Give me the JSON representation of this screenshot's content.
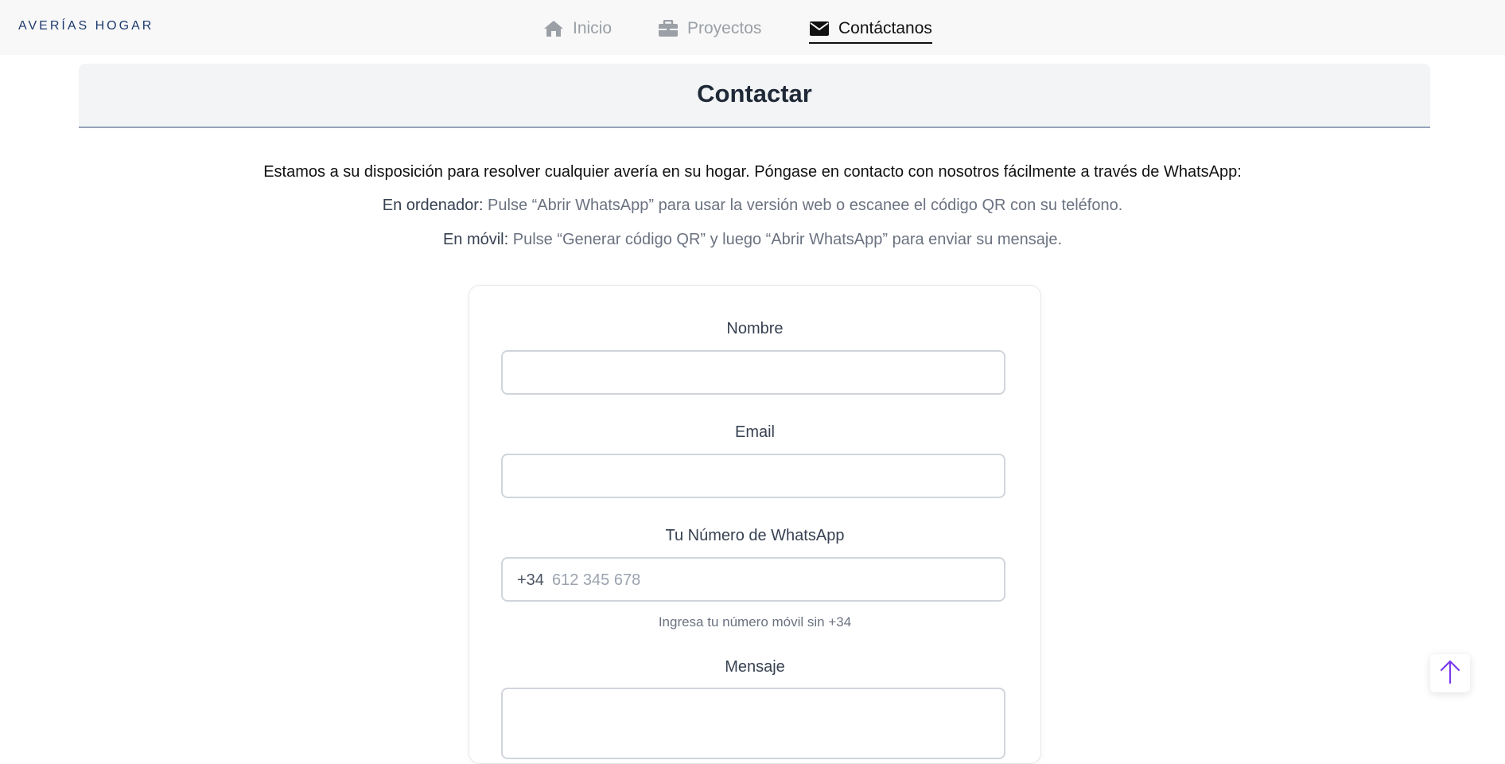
{
  "brand": "AVERÍAS HOGAR",
  "nav": {
    "items": [
      {
        "label": "Inicio",
        "icon": "home-icon",
        "active": false
      },
      {
        "label": "Proyectos",
        "icon": "briefcase-icon",
        "active": false
      },
      {
        "label": "Contáctanos",
        "icon": "envelope-icon",
        "active": true
      }
    ]
  },
  "page": {
    "title": "Contactar"
  },
  "intro": {
    "line1": "Estamos a su disposición para resolver cualquier avería en su hogar. Póngase en contacto con nosotros fácilmente a través de WhatsApp:",
    "line2_label": "En ordenador:",
    "line2_text": " Pulse “Abrir WhatsApp” para usar la versión web o escanee el código QR con su teléfono.",
    "line3_label": "En móvil:",
    "line3_text": " Pulse “Generar código QR” y luego “Abrir WhatsApp” para enviar su mensaje."
  },
  "form": {
    "name_label": "Nombre",
    "name_value": "",
    "email_label": "Email",
    "email_value": "",
    "phone_label": "Tu Número de WhatsApp",
    "phone_prefix": "+34",
    "phone_placeholder": "612 345 678",
    "phone_help": "Ingresa tu número móvil sin +34",
    "message_label": "Mensaje",
    "message_value": ""
  },
  "colors": {
    "brand": "#1e3a6e",
    "nav_inactive": "#9aa0a6",
    "nav_active": "#111111",
    "scroll_top_arrow": "#7c3aed"
  },
  "scroll_top_icon": "arrow-up-icon"
}
